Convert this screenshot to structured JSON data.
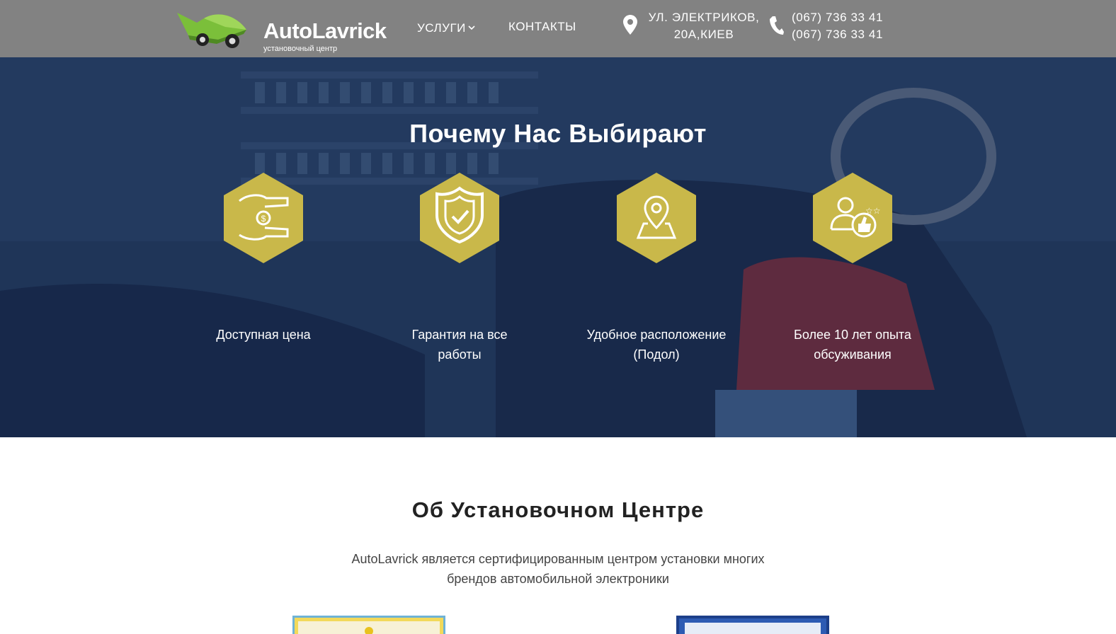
{
  "header": {
    "logo_title": "AutoLavrick",
    "logo_subtitle": "установочный центр",
    "nav": {
      "services": "УСЛУГИ",
      "contacts": "КОНТАКТЫ"
    },
    "address_line1": "УЛ. ЭЛЕКТРИКОВ,",
    "address_line2": "20А,КИЕВ",
    "phone1": "(067) 736 33 41",
    "phone2": "(067) 736 33 41"
  },
  "hero": {
    "title": "Почему Нас Выбирают",
    "features": [
      {
        "line1": "Доступная цена",
        "line2": "",
        "icon": "hand-money-icon"
      },
      {
        "line1": "Гарантия на все",
        "line2": "работы",
        "icon": "shield-check-icon"
      },
      {
        "line1": "Удобное расположение",
        "line2": "(Подол)",
        "icon": "map-pin-icon"
      },
      {
        "line1": "Более 10 лет опыта",
        "line2": "обсуживания",
        "icon": "user-rating-icon"
      }
    ]
  },
  "about": {
    "title": "Об Установочном Центре",
    "text_line1": "AutoLavrick является сертифицированным центром установки многих",
    "text_line2": "брендов автомобильной электроники"
  },
  "colors": {
    "header_bg": "#828282",
    "hex_gold": "#c9b84a",
    "hero_overlay": "#1f3558",
    "logo_green": "#7bbf3a"
  }
}
